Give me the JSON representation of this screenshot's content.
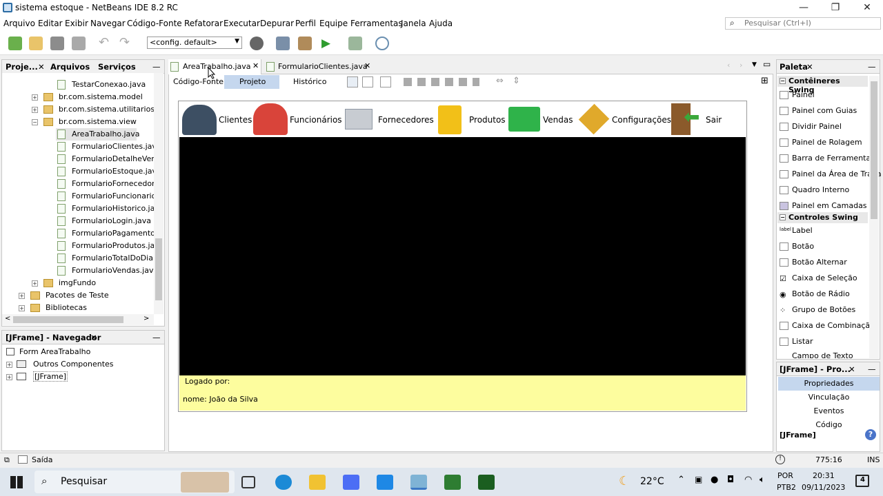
{
  "window": {
    "title": "sistema estoque - NetBeans IDE 8.2 RC",
    "min": "—",
    "max": "❐",
    "close": "✕"
  },
  "menu": [
    "Arquivo",
    "Editar",
    "Exibir",
    "Navegar",
    "Código-Fonte",
    "Refatorar",
    "Executar",
    "Depurar",
    "Perfil",
    "Equipe",
    "Ferramentas",
    "Janela",
    "Ajuda"
  ],
  "search": {
    "placeholder": "Pesquisar (Ctrl+I)"
  },
  "toolbar": {
    "config": "<config. default>"
  },
  "project_panel": {
    "tabs": [
      "Proje...",
      "Arquivos",
      "Serviços"
    ],
    "tree": [
      {
        "label": "TestarConexao.java",
        "type": "java"
      },
      {
        "label": "br.com.sistema.model",
        "type": "package"
      },
      {
        "label": "br.com.sistema.utilitarios",
        "type": "package"
      },
      {
        "label": "br.com.sistema.view",
        "type": "package-open"
      },
      {
        "label": "AreaTrabalho.java",
        "type": "java-selected"
      },
      {
        "label": "FormularioClientes.java",
        "type": "java"
      },
      {
        "label": "FormularioDetalheVenda",
        "type": "java"
      },
      {
        "label": "FormularioEstoque.java",
        "type": "java"
      },
      {
        "label": "FormularioFornecedores",
        "type": "java"
      },
      {
        "label": "FormularioFuncionarios.j",
        "type": "java"
      },
      {
        "label": "FormularioHistorico.java",
        "type": "java"
      },
      {
        "label": "FormularioLogin.java",
        "type": "java"
      },
      {
        "label": "FormularioPagamentos.j",
        "type": "java"
      },
      {
        "label": "FormularioProdutos.java",
        "type": "java"
      },
      {
        "label": "FormularioTotalDoDia.jav",
        "type": "java"
      },
      {
        "label": "FormularioVendas.java",
        "type": "java"
      },
      {
        "label": "imgFundo",
        "type": "package"
      },
      {
        "label": "Pacotes de Teste",
        "type": "folder"
      },
      {
        "label": "Bibliotecas",
        "type": "folder"
      }
    ]
  },
  "navigator": {
    "title": "[JFrame] - Navegador",
    "items": [
      "Form AreaTrabalho",
      "Outros Componentes",
      "[JFrame]"
    ]
  },
  "editor": {
    "tabs": [
      "AreaTrabalho.java",
      "FormularioClientes.java"
    ],
    "views": [
      "Código-Fonte",
      "Projeto",
      "Histórico"
    ],
    "active_view": "Projeto"
  },
  "form": {
    "buttons": [
      "Clientes",
      "Funcionários",
      "Fornecedores",
      "Produtos",
      "Vendas",
      "Configurações",
      "Sair"
    ],
    "logged_label": "Logado por:",
    "name_label": "nome:  João da Silva"
  },
  "palette": {
    "title": "Paleta",
    "cat1": "Contêineres Swing",
    "containers": [
      "Painel",
      "Painel com Guias",
      "Dividir Painel",
      "Painel de Rolagem",
      "Barra de Ferramentas",
      "Painel da Área de Traba",
      "Quadro Interno",
      "Painel em Camadas"
    ],
    "cat2": "Controles Swing",
    "controls": [
      "Label",
      "Botão",
      "Botão Alternar",
      "Caixa de Seleção",
      "Botão de Rádio",
      "Grupo de Botões",
      "Caixa de Combinação",
      "Listar",
      "Campo de Texto"
    ]
  },
  "properties": {
    "title": "[JFrame] - Pro...",
    "items": [
      "Propriedades",
      "Vinculação",
      "Eventos",
      "Código"
    ],
    "footer": "[JFrame]"
  },
  "status": {
    "output": "Saída",
    "position": "775:16",
    "mode": "INS"
  },
  "taskbar": {
    "search": "Pesquisar",
    "temp": "22°C",
    "lang1": "POR",
    "lang2": "PTB2",
    "time": "20:31",
    "date": "09/11/2023",
    "notif": "4"
  },
  "colors": {
    "selection": "#c5d7ee",
    "form_yellow": "#fdfd9e",
    "accent": "#2b6ca3"
  }
}
